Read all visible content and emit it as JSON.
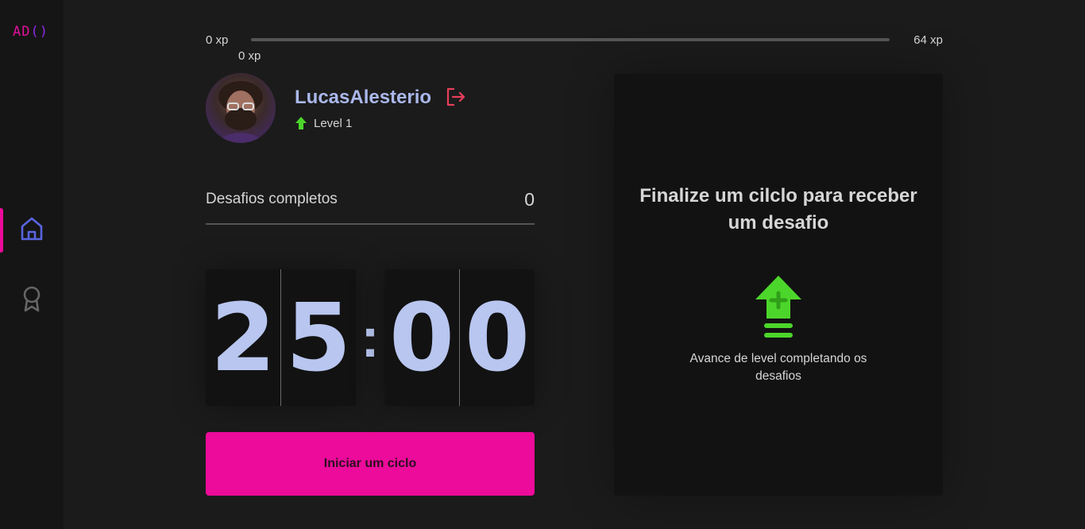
{
  "sidebar": {
    "logo_part1": "AD",
    "logo_part2": "()",
    "items": [
      {
        "name": "home",
        "active": true
      },
      {
        "name": "award",
        "active": false
      }
    ]
  },
  "experience": {
    "min_label": "0 xp",
    "max_label": "64 xp",
    "current_label": "0 xp",
    "progress_percent": 0
  },
  "profile": {
    "username": "LucasAlesterio",
    "level_label": "Level 1"
  },
  "challenges": {
    "label": "Desafios completos",
    "count": "0"
  },
  "countdown": {
    "minute_left": "2",
    "minute_right": "5",
    "separator": ":",
    "second_left": "0",
    "second_right": "0"
  },
  "start_button": {
    "label": "Iniciar um ciclo"
  },
  "challenge_box": {
    "title": "Finalize um cilclo para receber um desafio",
    "description": "Avance de level completando os desafios"
  },
  "colors": {
    "accent": "#ec0b9a",
    "primary": "#aab8ea",
    "green": "#4cd62b",
    "logout": "#e83f5b"
  }
}
